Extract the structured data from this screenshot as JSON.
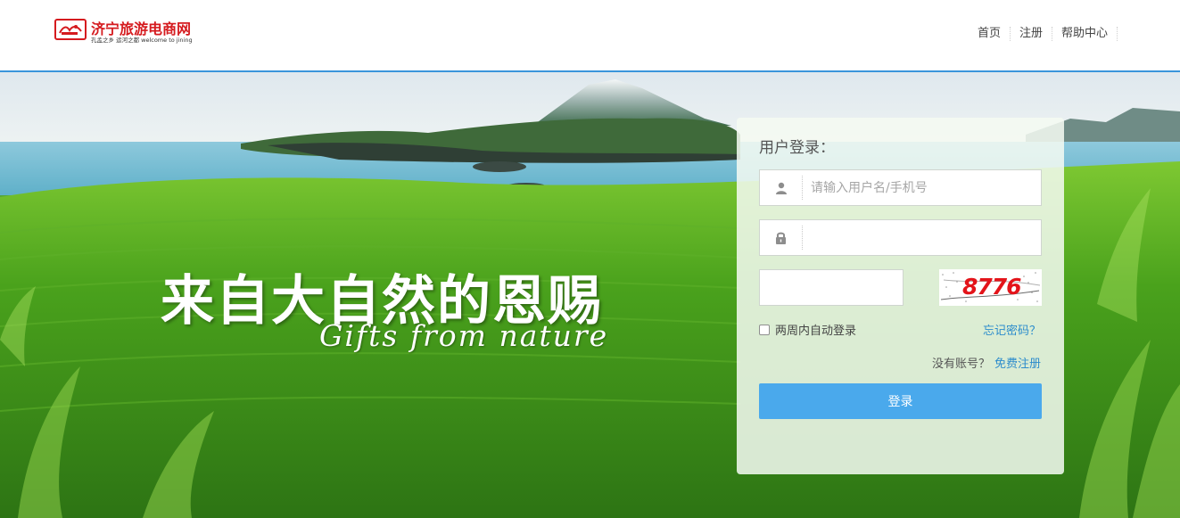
{
  "header": {
    "logo_name": "济宁旅游电商网",
    "logo_tagline": "孔孟之乡 运河之都 welcome to jining",
    "nav": [
      {
        "label": "首页"
      },
      {
        "label": "注册"
      },
      {
        "label": "帮助中心"
      }
    ]
  },
  "hero": {
    "slogan_cn": "来自大自然的恩赐",
    "slogan_en": "Gifts from nature"
  },
  "login": {
    "title": "用户登录：",
    "username_placeholder": "请输入用户名/手机号",
    "username_value": "",
    "password_value": "",
    "captcha_input_value": "",
    "captcha_code": "8776",
    "remember_label": "两周内自动登录",
    "remember_checked": false,
    "forgot_label": "忘记密码？",
    "no_account_label": "没有账号？",
    "register_label": "免费注册",
    "submit_label": "登录",
    "icons": {
      "username": "user-icon",
      "password": "lock-icon"
    }
  },
  "colors": {
    "brand_red": "#d51b1f",
    "header_border": "#3a95db",
    "link_blue": "#2d8ccc",
    "button_blue": "#4aa9ec",
    "captcha_red": "#e3141a"
  }
}
